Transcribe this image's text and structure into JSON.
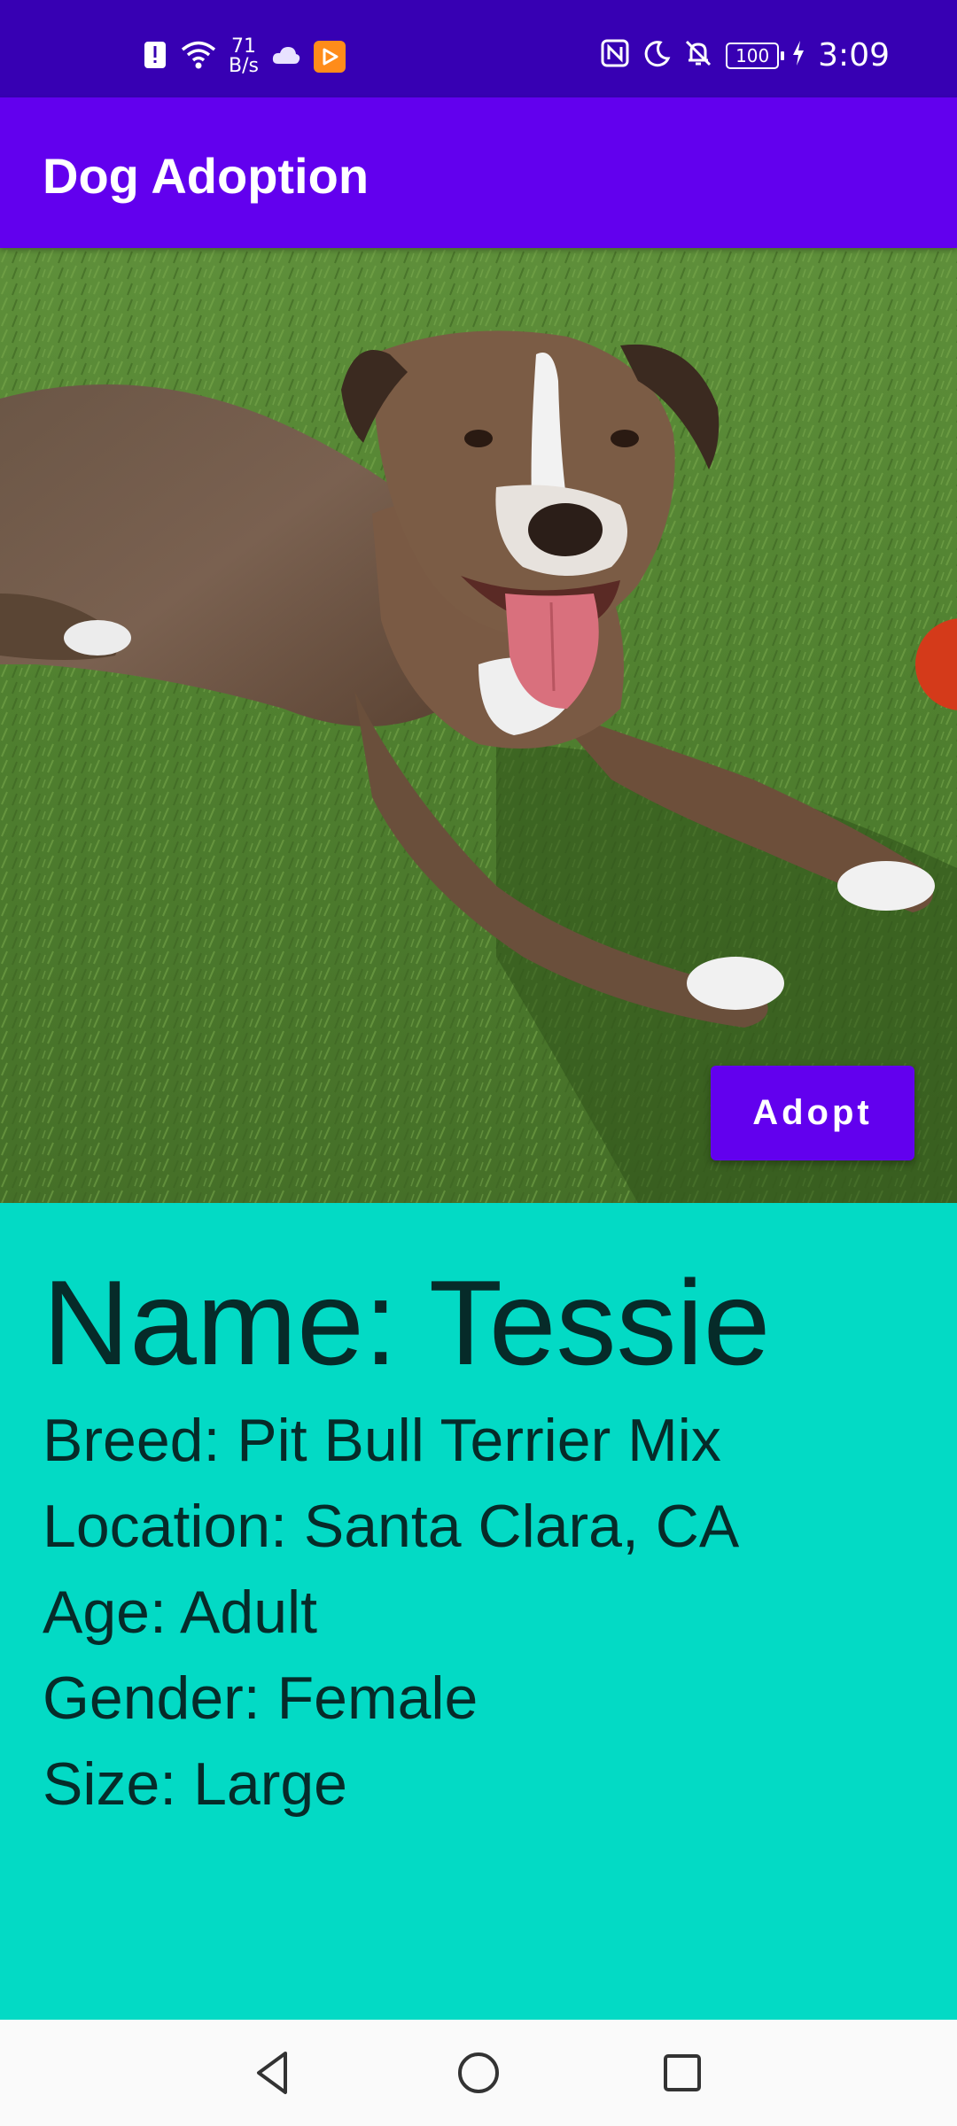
{
  "status_bar": {
    "net_speed_value": "71",
    "net_speed_unit": "B/s",
    "battery": "100",
    "time": "3:09",
    "icons_left": [
      "alert-icon",
      "wifi-icon",
      "cloud-icon",
      "play-app-icon"
    ],
    "icons_right": [
      "nfc-icon",
      "moon-icon",
      "bell-off-icon",
      "battery-icon",
      "charging-icon"
    ]
  },
  "app_bar": {
    "title": "Dog Adoption"
  },
  "photo": {
    "adopt_label": "Adopt"
  },
  "details": {
    "name": "Name: Tessie",
    "breed": "Breed: Pit Bull Terrier Mix",
    "location": "Location: Santa Clara, CA",
    "age": "Age: Adult",
    "gender": "Gender: Female",
    "size": "Size: Large"
  },
  "nav_bar": {
    "buttons": [
      "back-icon",
      "home-icon",
      "recents-icon"
    ]
  },
  "colors": {
    "status_bar": "#3700B3",
    "primary": "#6200EE",
    "details_bg": "#03DAC5",
    "nav_bg": "#FAFAFA"
  }
}
